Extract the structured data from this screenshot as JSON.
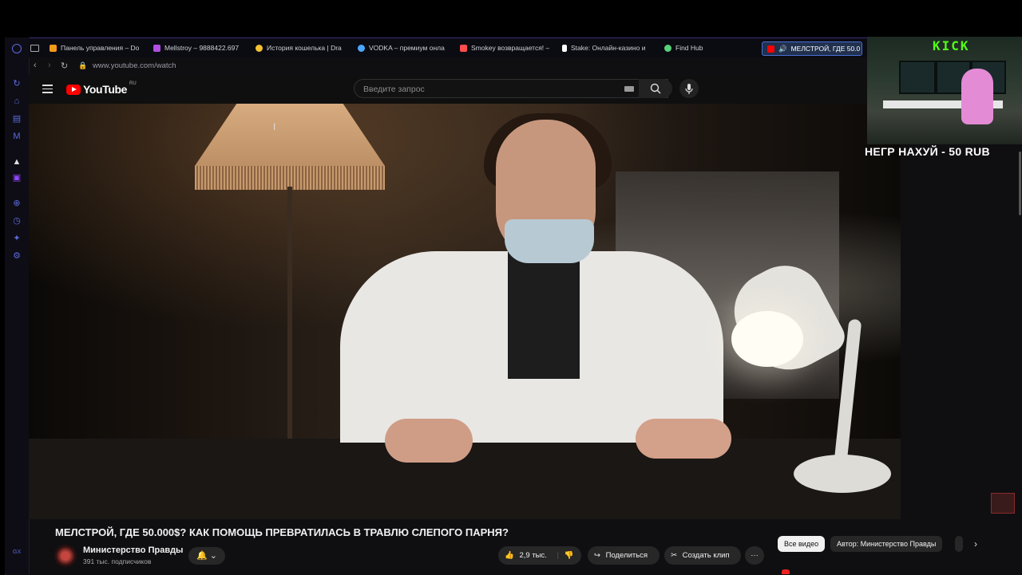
{
  "browser": {
    "tabs": [
      {
        "label": "Панель управления – Do",
        "fav_color": "#f29a1a"
      },
      {
        "label": "Mellstroy – 9888422.697",
        "fav_color": "#b04fe0"
      },
      {
        "label": "История кошелька | Dra",
        "fav_color": "#f2c230"
      },
      {
        "label": "VODKA – премиум онла",
        "fav_color": "#4aa8ff"
      },
      {
        "label": "Smokey возвращается! –",
        "fav_color": "#ff4d4d"
      },
      {
        "label": "Stake: Онлайн-казино и",
        "fav_color": "#ffffff"
      },
      {
        "label": "Find Hub",
        "fav_color": "#59d07a"
      },
      {
        "label": "МЕЛСТРОЙ, ГДЕ 50.0",
        "fav_color": "#ff0000"
      }
    ],
    "url": "www.youtube.com/watch"
  },
  "youtube": {
    "logo_text": "YouTube",
    "region": "RU",
    "search_placeholder": "Введите запрос"
  },
  "video": {
    "title": "МЕЛСТРОЙ, ГДЕ 50.000$? КАК ПОМОЩЬ ПРЕВРАТИЛАСЬ В ТРАВЛЮ СЛЕПОГО ПАРНЯ?",
    "channel": "Министерство Правды",
    "subscribers": "391 тыс. подписчиков",
    "likes": "2,9 тыс.",
    "share_label": "Поделиться",
    "clip_label": "Создать клип",
    "more_label": "···"
  },
  "chips": {
    "all": "Все видео",
    "author": "Автор: Министерство Правды"
  },
  "overlay": {
    "kick_label": "KICK",
    "donation_text": "НЕГР НАХУЙ - 50 RUB"
  },
  "sidebar": {
    "gx_label": "GX"
  }
}
